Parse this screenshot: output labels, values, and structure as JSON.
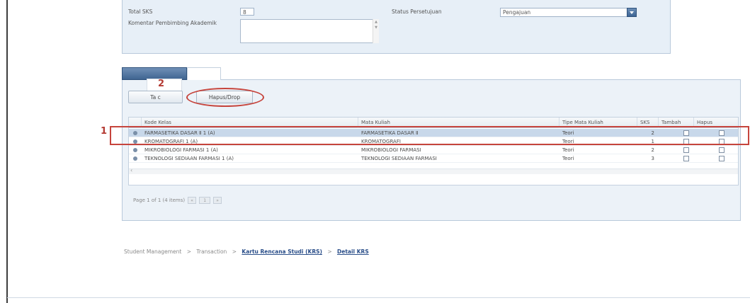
{
  "form": {
    "total_sks_label": "Total SKS",
    "total_sks_value": "8",
    "komentar_label": "Komentar Pembimbing Akademik",
    "komentar_value": "",
    "status_label": "Status Persetujuan",
    "status_value": "Pengajuan"
  },
  "tabs": [
    {
      "label": ""
    },
    {
      "label": ""
    }
  ],
  "annotations": {
    "step1": "1",
    "step2": "2"
  },
  "toolbar": {
    "tambah_label": "Ta         c",
    "hapus_drop_label": "Hapus/Drop"
  },
  "grid": {
    "columns": [
      "Kode Kelas",
      "Mata Kuliah",
      "Tipe Mata Kuliah",
      "SKS",
      "Tambah",
      "Hapus"
    ],
    "rows": [
      {
        "kode": "FARMASETIKA DASAR Ⅱ 1 (A)",
        "mata_kuliah": "FARMASETIKA DASAR Ⅱ",
        "tipe": "Teori",
        "sks": "2",
        "selected": true
      },
      {
        "kode": "KROMATOGRAFI 1 (A)",
        "mata_kuliah": "KROMATOGRAFI",
        "tipe": "Teori",
        "sks": "1",
        "selected": false
      },
      {
        "kode": "MIKROBIOLOGI FARMASI 1 (A)",
        "mata_kuliah": "MIKROBIOLOGI FARMASI",
        "tipe": "Teori",
        "sks": "2",
        "selected": false
      },
      {
        "kode": "TEKNOLOGI SEDIAAN FARMASI 1 (A)",
        "mata_kuliah": "TEKNOLOGI SEDIAAN FARMASI",
        "tipe": "Teori",
        "sks": "3",
        "selected": false
      }
    ]
  },
  "pager": {
    "text": "Page 1 of 1 (4 items)",
    "page_number": "1"
  },
  "breadcrumb": {
    "item1": "Student Management",
    "item2": "Transaction",
    "item3": "Kartu Rencana Studi (KRS)",
    "item4": "Detail KRS",
    "separator": ">"
  },
  "colors": {
    "highlight_red": "#c6443c",
    "panel_bg": "#e7eff7",
    "selected_row": "#c8d8ea",
    "link_blue": "#2b4f8a"
  },
  "icons": [
    "select-dropdown-icon",
    "row-expander-icon",
    "checkbox-icon",
    "pager-first-icon",
    "pager-last-icon"
  ]
}
